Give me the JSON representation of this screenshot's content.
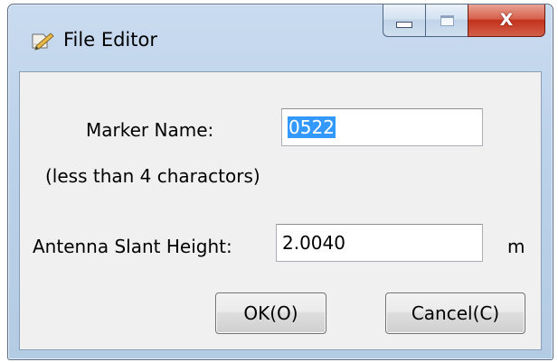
{
  "window": {
    "title": "File Editor",
    "close_glyph": "X",
    "title_icon": "edit-file-icon"
  },
  "form": {
    "marker_label": "Marker Name:",
    "marker_value": "0522",
    "marker_hint": "(less than 4 charactors)",
    "antenna_label": "Antenna Slant Height:",
    "antenna_value": "2.0040",
    "antenna_unit": "m"
  },
  "buttons": {
    "ok_label": "OK(O)",
    "cancel_label": "Cancel(C)"
  },
  "colors": {
    "selection": "#3399ff",
    "close_button": "#c4321c",
    "frame": "#bcd2ea"
  }
}
